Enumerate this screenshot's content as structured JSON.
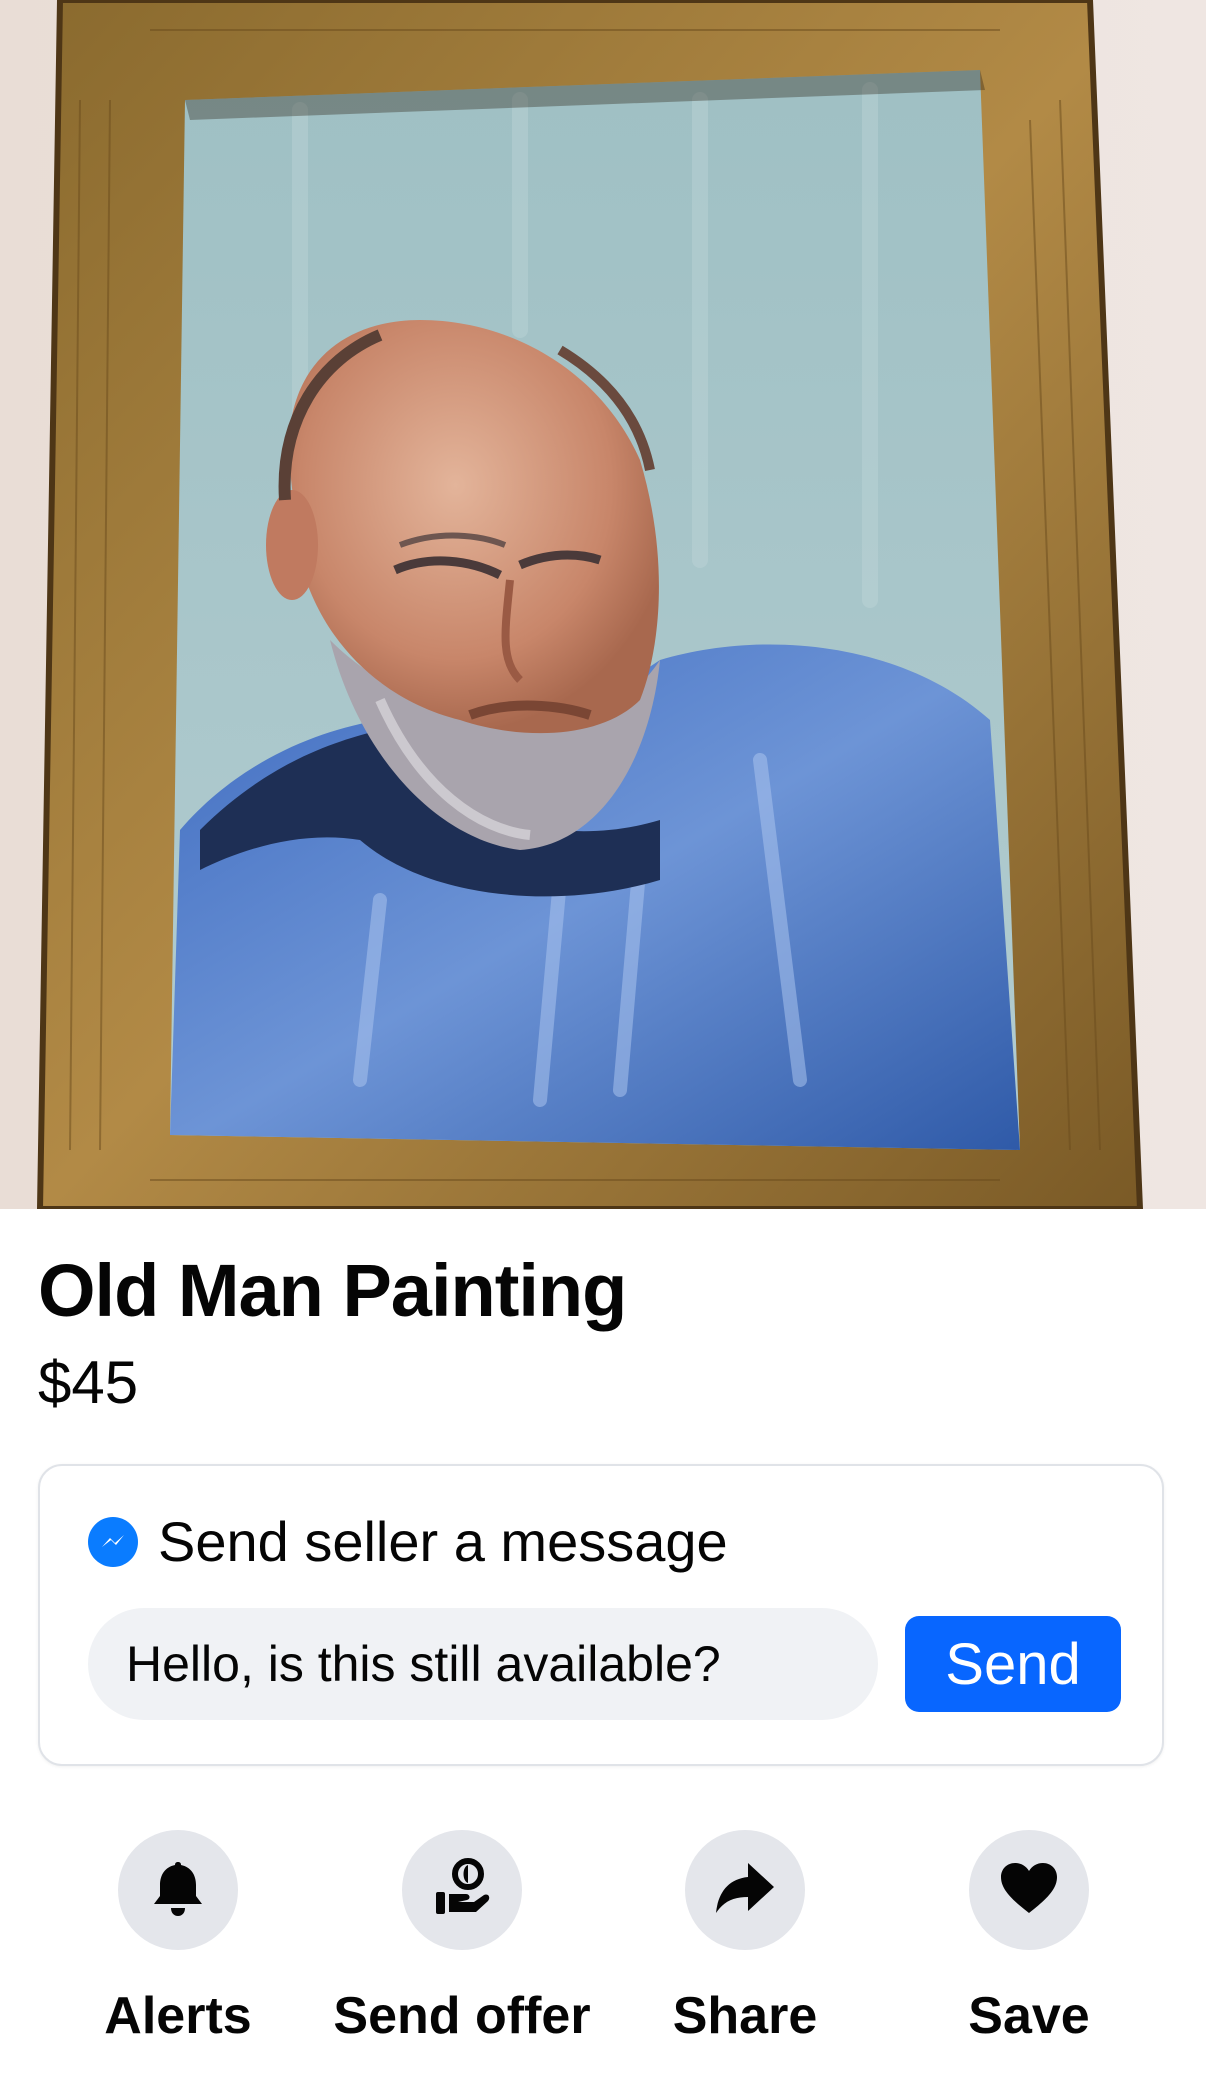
{
  "listing": {
    "title": "Old Man Painting",
    "price": "$45",
    "photo_icon": "painting-photo"
  },
  "message": {
    "header": "Send seller a message",
    "header_icon": "messenger-icon",
    "input_value": "Hello, is this still available?",
    "send_label": "Send"
  },
  "actions": [
    {
      "label": "Alerts",
      "icon": "bell-icon"
    },
    {
      "label": "Send offer",
      "icon": "send-offer-icon"
    },
    {
      "label": "Share",
      "icon": "share-icon"
    },
    {
      "label": "Save",
      "icon": "heart-icon"
    }
  ],
  "colors": {
    "accent": "#0866ff",
    "messenger": "#0a7cff",
    "input_bg": "#f0f2f5",
    "action_circle_bg": "#e4e6eb"
  }
}
